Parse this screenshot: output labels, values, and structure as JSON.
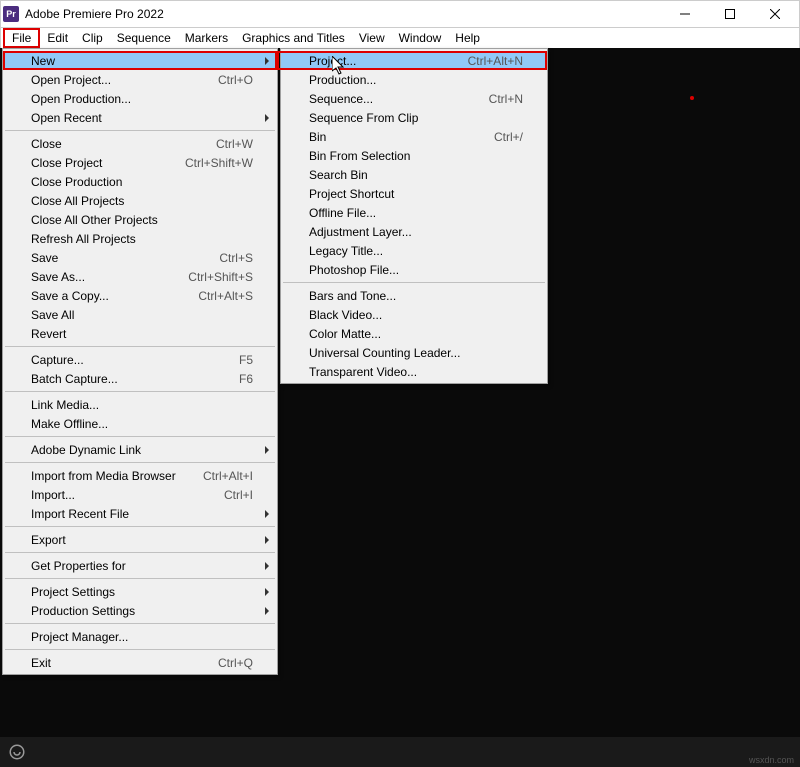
{
  "titlebar": {
    "icon_text": "Pr",
    "title": "Adobe Premiere Pro 2022"
  },
  "menubar": [
    "File",
    "Edit",
    "Clip",
    "Sequence",
    "Markers",
    "Graphics and Titles",
    "View",
    "Window",
    "Help"
  ],
  "file_menu": [
    {
      "t": "item",
      "label": "New",
      "shortcut": "",
      "sub": true,
      "hl": true,
      "name": "file-new"
    },
    {
      "t": "item",
      "label": "Open Project...",
      "shortcut": "Ctrl+O",
      "name": "file-open-project"
    },
    {
      "t": "item",
      "label": "Open Production...",
      "shortcut": "",
      "name": "file-open-production"
    },
    {
      "t": "item",
      "label": "Open Recent",
      "shortcut": "",
      "sub": true,
      "name": "file-open-recent"
    },
    {
      "t": "sep"
    },
    {
      "t": "item",
      "label": "Close",
      "shortcut": "Ctrl+W",
      "name": "file-close"
    },
    {
      "t": "item",
      "label": "Close Project",
      "shortcut": "Ctrl+Shift+W",
      "name": "file-close-project"
    },
    {
      "t": "item",
      "label": "Close Production",
      "shortcut": "",
      "name": "file-close-production"
    },
    {
      "t": "item",
      "label": "Close All Projects",
      "shortcut": "",
      "name": "file-close-all-projects"
    },
    {
      "t": "item",
      "label": "Close All Other Projects",
      "shortcut": "",
      "name": "file-close-all-other"
    },
    {
      "t": "item",
      "label": "Refresh All Projects",
      "shortcut": "",
      "name": "file-refresh-all"
    },
    {
      "t": "item",
      "label": "Save",
      "shortcut": "Ctrl+S",
      "name": "file-save"
    },
    {
      "t": "item",
      "label": "Save As...",
      "shortcut": "Ctrl+Shift+S",
      "name": "file-save-as"
    },
    {
      "t": "item",
      "label": "Save a Copy...",
      "shortcut": "Ctrl+Alt+S",
      "name": "file-save-copy"
    },
    {
      "t": "item",
      "label": "Save All",
      "shortcut": "",
      "name": "file-save-all"
    },
    {
      "t": "item",
      "label": "Revert",
      "shortcut": "",
      "name": "file-revert"
    },
    {
      "t": "sep"
    },
    {
      "t": "item",
      "label": "Capture...",
      "shortcut": "F5",
      "name": "file-capture"
    },
    {
      "t": "item",
      "label": "Batch Capture...",
      "shortcut": "F6",
      "name": "file-batch-capture"
    },
    {
      "t": "sep"
    },
    {
      "t": "item",
      "label": "Link Media...",
      "shortcut": "",
      "name": "file-link-media"
    },
    {
      "t": "item",
      "label": "Make Offline...",
      "shortcut": "",
      "name": "file-make-offline"
    },
    {
      "t": "sep"
    },
    {
      "t": "item",
      "label": "Adobe Dynamic Link",
      "shortcut": "",
      "sub": true,
      "name": "file-dynamic-link"
    },
    {
      "t": "sep"
    },
    {
      "t": "item",
      "label": "Import from Media Browser",
      "shortcut": "Ctrl+Alt+I",
      "name": "file-import-media-browser"
    },
    {
      "t": "item",
      "label": "Import...",
      "shortcut": "Ctrl+I",
      "name": "file-import"
    },
    {
      "t": "item",
      "label": "Import Recent File",
      "shortcut": "",
      "sub": true,
      "name": "file-import-recent"
    },
    {
      "t": "sep"
    },
    {
      "t": "item",
      "label": "Export",
      "shortcut": "",
      "sub": true,
      "name": "file-export"
    },
    {
      "t": "sep"
    },
    {
      "t": "item",
      "label": "Get Properties for",
      "shortcut": "",
      "sub": true,
      "name": "file-get-properties"
    },
    {
      "t": "sep"
    },
    {
      "t": "item",
      "label": "Project Settings",
      "shortcut": "",
      "sub": true,
      "name": "file-project-settings"
    },
    {
      "t": "item",
      "label": "Production Settings",
      "shortcut": "",
      "sub": true,
      "name": "file-production-settings"
    },
    {
      "t": "sep"
    },
    {
      "t": "item",
      "label": "Project Manager...",
      "shortcut": "",
      "name": "file-project-manager"
    },
    {
      "t": "sep"
    },
    {
      "t": "item",
      "label": "Exit",
      "shortcut": "Ctrl+Q",
      "name": "file-exit"
    }
  ],
  "new_submenu": [
    {
      "t": "item",
      "label": "Project...",
      "shortcut": "Ctrl+Alt+N",
      "hl": true,
      "name": "new-project"
    },
    {
      "t": "item",
      "label": "Production...",
      "shortcut": "",
      "name": "new-production"
    },
    {
      "t": "item",
      "label": "Sequence...",
      "shortcut": "Ctrl+N",
      "name": "new-sequence"
    },
    {
      "t": "item",
      "label": "Sequence From Clip",
      "shortcut": "",
      "name": "new-sequence-from-clip"
    },
    {
      "t": "item",
      "label": "Bin",
      "shortcut": "Ctrl+/",
      "name": "new-bin"
    },
    {
      "t": "item",
      "label": "Bin From Selection",
      "shortcut": "",
      "name": "new-bin-from-selection"
    },
    {
      "t": "item",
      "label": "Search Bin",
      "shortcut": "",
      "name": "new-search-bin"
    },
    {
      "t": "item",
      "label": "Project Shortcut",
      "shortcut": "",
      "name": "new-project-shortcut"
    },
    {
      "t": "item",
      "label": "Offline File...",
      "shortcut": "",
      "name": "new-offline-file"
    },
    {
      "t": "item",
      "label": "Adjustment Layer...",
      "shortcut": "",
      "name": "new-adjustment-layer"
    },
    {
      "t": "item",
      "label": "Legacy Title...",
      "shortcut": "",
      "name": "new-legacy-title"
    },
    {
      "t": "item",
      "label": "Photoshop File...",
      "shortcut": "",
      "name": "new-photoshop-file"
    },
    {
      "t": "sep"
    },
    {
      "t": "item",
      "label": "Bars and Tone...",
      "shortcut": "",
      "name": "new-bars-tone"
    },
    {
      "t": "item",
      "label": "Black Video...",
      "shortcut": "",
      "name": "new-black-video"
    },
    {
      "t": "item",
      "label": "Color Matte...",
      "shortcut": "",
      "name": "new-color-matte"
    },
    {
      "t": "item",
      "label": "Universal Counting Leader...",
      "shortcut": "",
      "name": "new-counting-leader"
    },
    {
      "t": "item",
      "label": "Transparent Video...",
      "shortcut": "",
      "name": "new-transparent-video"
    }
  ],
  "watermark": "wsxdn.com"
}
